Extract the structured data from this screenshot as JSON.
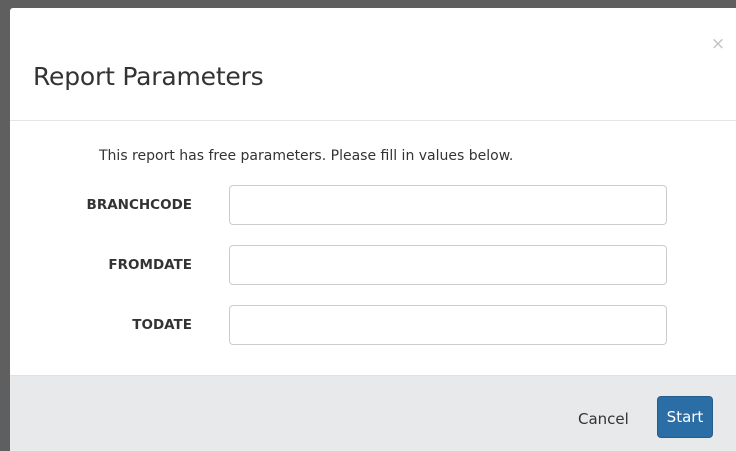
{
  "modal": {
    "title": "Report Parameters",
    "close_symbol": "×",
    "intro_text": "This report has free parameters. Please fill in values below.",
    "fields": [
      {
        "label": "BRANCHCODE",
        "value": ""
      },
      {
        "label": "FROMDATE",
        "value": ""
      },
      {
        "label": "TODATE",
        "value": ""
      }
    ],
    "footer": {
      "cancel_label": "Cancel",
      "start_label": "Start"
    }
  },
  "colors": {
    "backdrop": "#5f5f5f",
    "footer_bg": "#e8e9ea",
    "primary_button": "#2b6ea6"
  }
}
